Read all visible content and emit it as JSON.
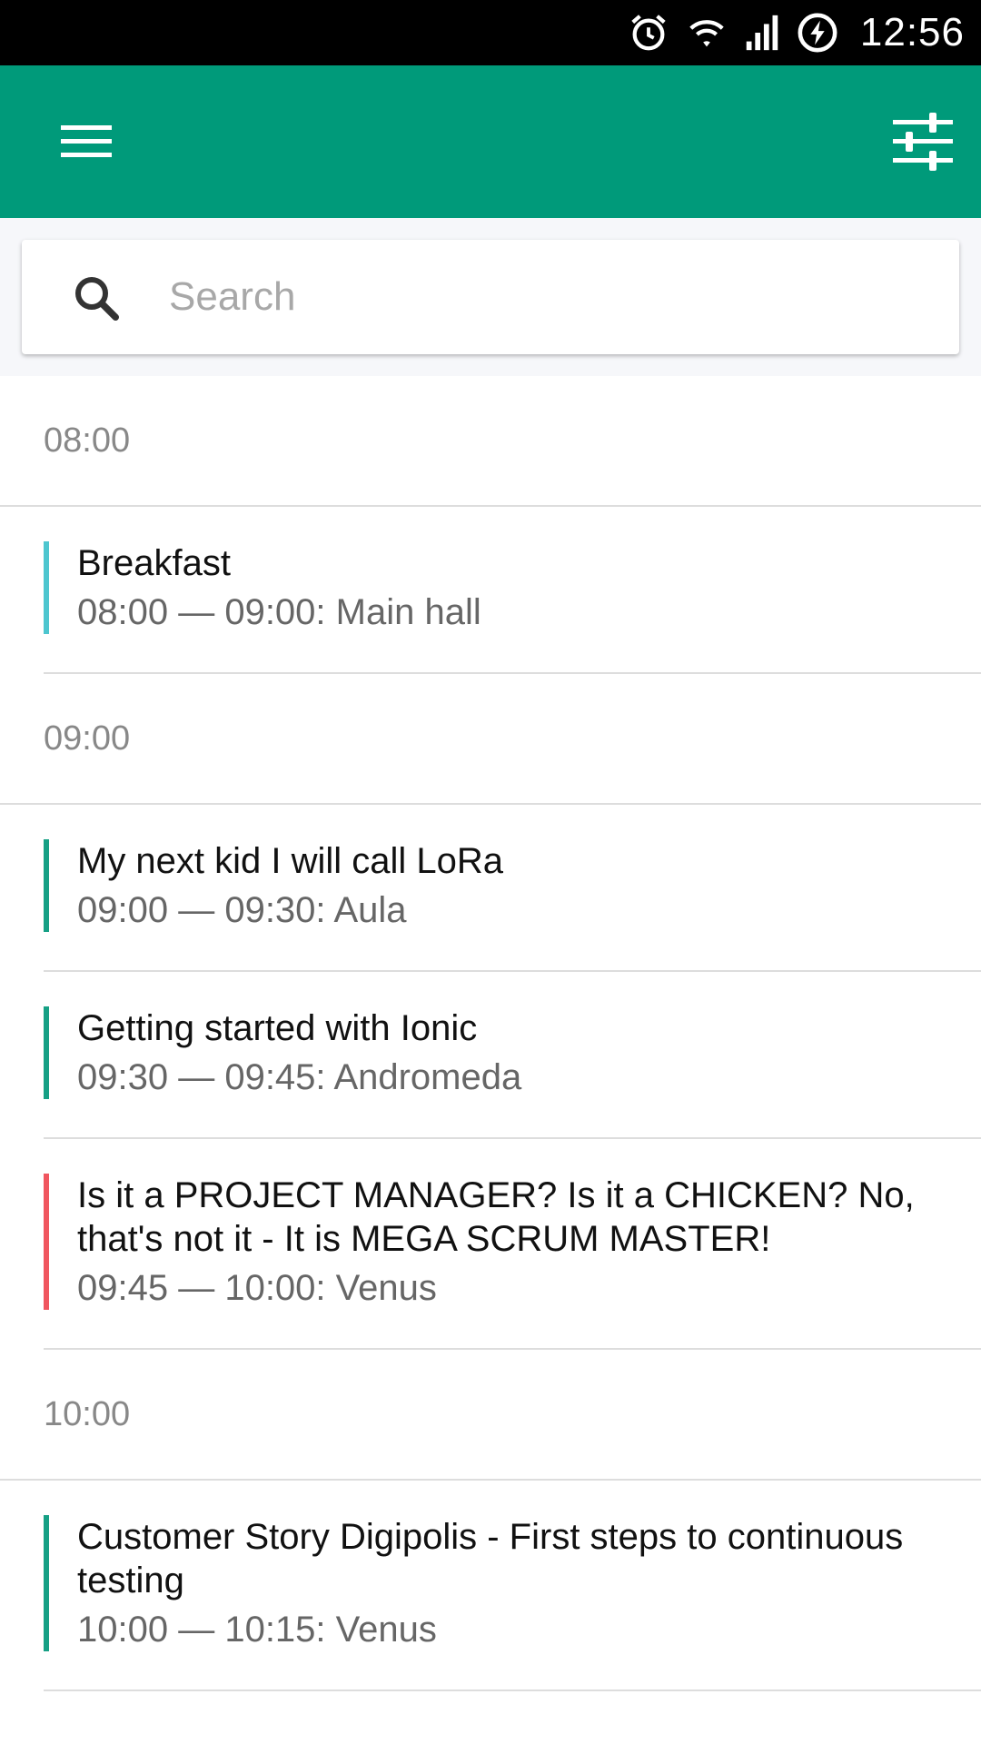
{
  "status_bar": {
    "time": "12:56",
    "icons": [
      "alarm-icon",
      "wifi-icon",
      "signal-icon",
      "battery-charging-icon"
    ]
  },
  "app_bar": {
    "color": "#009a7a",
    "left_icon": "menu-icon",
    "right_icon": "sliders-icon"
  },
  "search": {
    "placeholder": "Search",
    "value": ""
  },
  "groups": [
    {
      "time": "08:00",
      "sessions": [
        {
          "title": "Breakfast",
          "meta": "08:00 — 09:00: Main hall",
          "track_color": "#4dc6cf"
        }
      ]
    },
    {
      "time": "09:00",
      "sessions": [
        {
          "title": "My next kid I will call LoRa",
          "meta": "09:00 — 09:30: Aula",
          "track_color": "#16a085"
        },
        {
          "title": "Getting started with Ionic",
          "meta": "09:30 — 09:45: Andromeda",
          "track_color": "#16a085"
        },
        {
          "title": "Is it a PROJECT MANAGER? Is it a CHICKEN? No, that's not it - It is MEGA SCRUM MASTER!",
          "meta": "09:45 — 10:00: Venus",
          "track_color": "#f0565f"
        }
      ]
    },
    {
      "time": "10:00",
      "sessions": [
        {
          "title": "Customer Story Digipolis - First steps to continuous testing",
          "meta": "10:00 — 10:15: Venus",
          "track_color": "#16a085"
        }
      ]
    }
  ]
}
